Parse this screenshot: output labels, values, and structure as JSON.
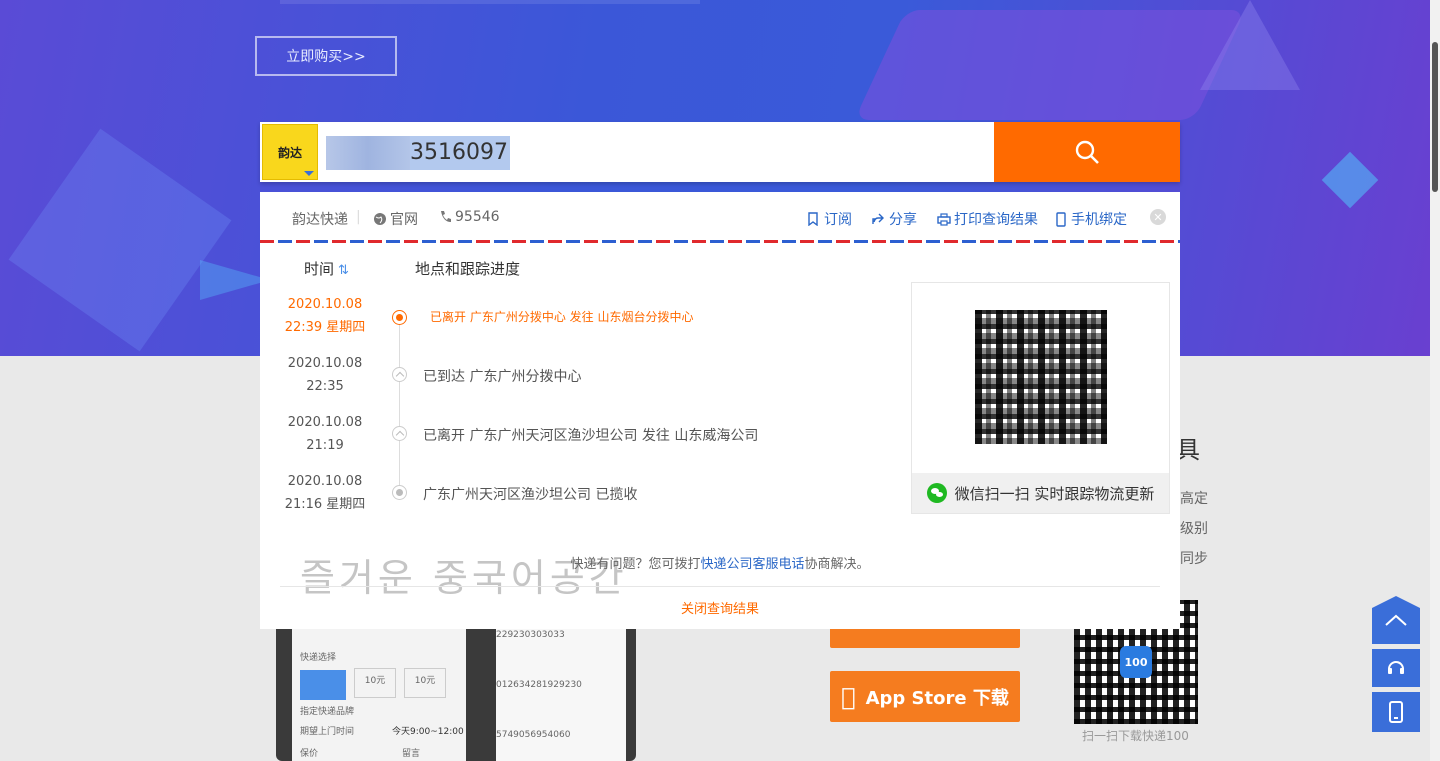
{
  "hero": {
    "buy_button": "立即购买>>"
  },
  "search": {
    "company_logo": "韵达",
    "tracking_number_visible": "3516097"
  },
  "result": {
    "header": {
      "company_name": "韵达快递",
      "official_site": "官网",
      "phone": "95546",
      "actions": [
        "订阅",
        "分享",
        "打印查询结果",
        "手机绑定"
      ]
    },
    "columns": {
      "time": "时间",
      "progress": "地点和跟踪进度"
    },
    "events": [
      {
        "date": "2020.10.08",
        "time": "22:39 星期四",
        "text": "已离开 广东广州分拨中心 发往 山东烟台分拨中心",
        "active": true
      },
      {
        "date": "2020.10.08",
        "time": "22:35",
        "text": "已到达 广东广州分拨中心",
        "active": false
      },
      {
        "date": "2020.10.08",
        "time": "21:19",
        "text": "已离开 广东广州天河区渔沙坦公司 发往 山东威海公司",
        "active": false
      },
      {
        "date": "2020.10.08",
        "time": "21:16  星期四",
        "text": "广东广州天河区渔沙坦公司 已揽收",
        "active": false
      }
    ],
    "qr_caption": "微信扫一扫 实时跟踪物流更新",
    "help": {
      "prefix": "快递有问题？您可拨打",
      "link": "快递公司客服电话",
      "suffix": "协商解决。"
    },
    "close_label": "关闭查询结果",
    "watermark": "즐거운 중국어공간"
  },
  "side": {
    "title_char": "具",
    "lines": [
      "高定",
      "级别",
      "同步"
    ],
    "appstore": "App Store 下载",
    "qr_label": "扫一扫下载快递100",
    "qr_badge": "100"
  },
  "phone_screen": {
    "select_label": "快递选择",
    "price1": "10元",
    "price2": "10元",
    "brand_label": "指定快递品牌",
    "pickup_label": "期望上门时间",
    "pickup_value": "今天9:00~12:00",
    "insure": "保价",
    "note": "留言",
    "list": [
      "229230303033",
      "012634281929230",
      "5749056954060"
    ]
  }
}
